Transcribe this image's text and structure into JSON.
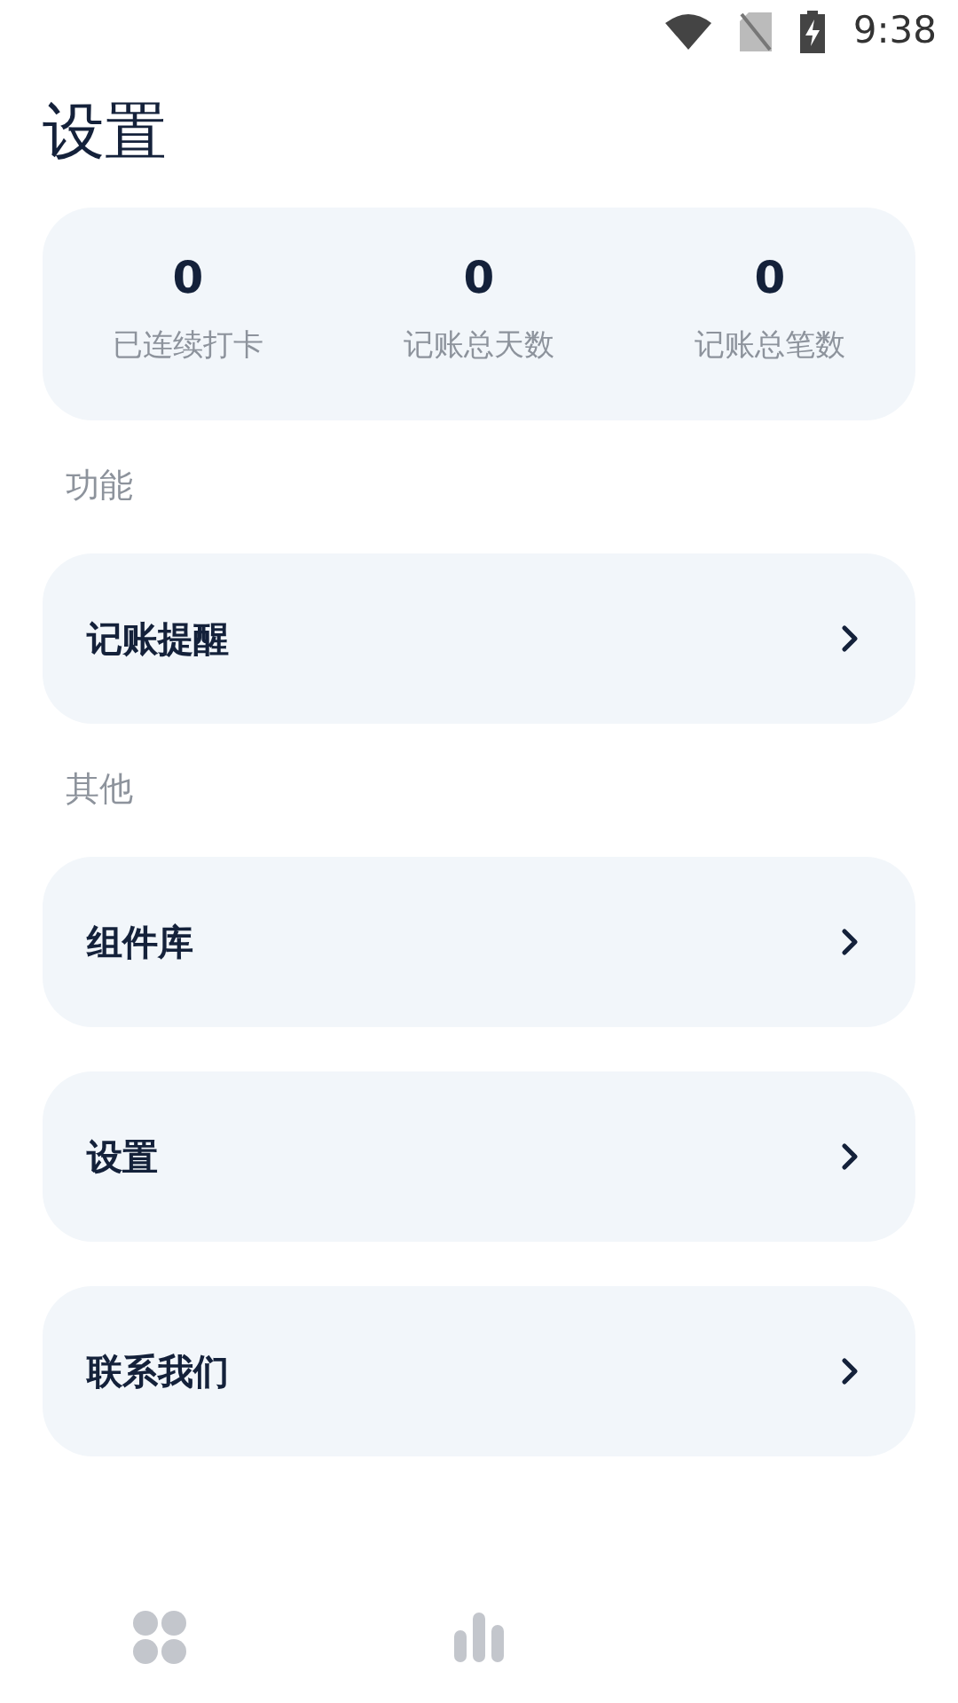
{
  "status_bar": {
    "time": "9:38"
  },
  "title": "设置",
  "stats": [
    {
      "value": "0",
      "label": "已连续打卡"
    },
    {
      "value": "0",
      "label": "记账总天数"
    },
    {
      "value": "0",
      "label": "记账总笔数"
    }
  ],
  "sections": [
    {
      "heading": "功能",
      "items": [
        {
          "label": "记账提醒"
        }
      ]
    },
    {
      "heading": "其他",
      "items": [
        {
          "label": "组件库"
        },
        {
          "label": "设置"
        },
        {
          "label": "联系我们"
        }
      ]
    }
  ]
}
